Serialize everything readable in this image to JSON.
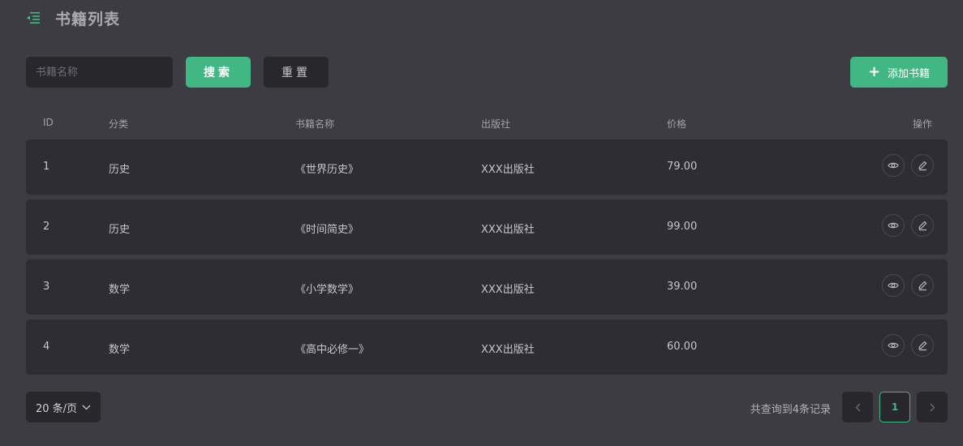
{
  "header": {
    "title": "书籍列表",
    "menu_icon": "menu-fold-icon",
    "accent": "#41b883"
  },
  "toolbar": {
    "search_placeholder": "书籍名称",
    "search_label": "搜索",
    "reset_label": "重置",
    "add_label": "添加书籍"
  },
  "table": {
    "columns": [
      "ID",
      "分类",
      "书籍名称",
      "出版社",
      "价格",
      "操作"
    ],
    "rows": [
      {
        "id": "1",
        "category": "历史",
        "name": "《世界历史》",
        "publisher": "XXX出版社",
        "price": "79.00"
      },
      {
        "id": "2",
        "category": "历史",
        "name": "《时间简史》",
        "publisher": "XXX出版社",
        "price": "99.00"
      },
      {
        "id": "3",
        "category": "数学",
        "name": "《小学数学》",
        "publisher": "XXX出版社",
        "price": "39.00"
      },
      {
        "id": "4",
        "category": "数学",
        "name": "《高中必修一》",
        "publisher": "XXX出版社",
        "price": "60.00"
      }
    ],
    "row_actions": [
      "eye-icon",
      "pencil-icon"
    ]
  },
  "pagination": {
    "page_size": "20 条/页",
    "total_text": "共查询到4条记录",
    "current_page": "1"
  }
}
